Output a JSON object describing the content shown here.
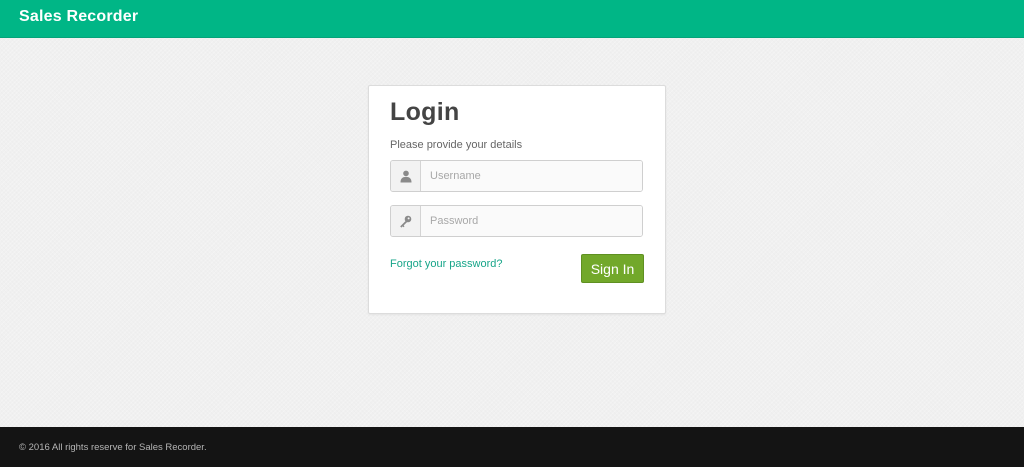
{
  "app": {
    "brand": "Sales Recorder"
  },
  "login": {
    "title": "Login",
    "subtitle": "Please provide your details",
    "username": {
      "placeholder": "Username",
      "value": "",
      "icon": "user-icon"
    },
    "password": {
      "placeholder": "Password",
      "value": "",
      "icon": "key-icon"
    },
    "forgot_label": "Forgot your password?",
    "submit_label": "Sign In"
  },
  "footer": {
    "text": "© 2016 All rights reserve for Sales Recorder."
  },
  "colors": {
    "navbar": "#00b686",
    "button": "#72a82a",
    "link": "#17a589",
    "footer": "#141414"
  }
}
